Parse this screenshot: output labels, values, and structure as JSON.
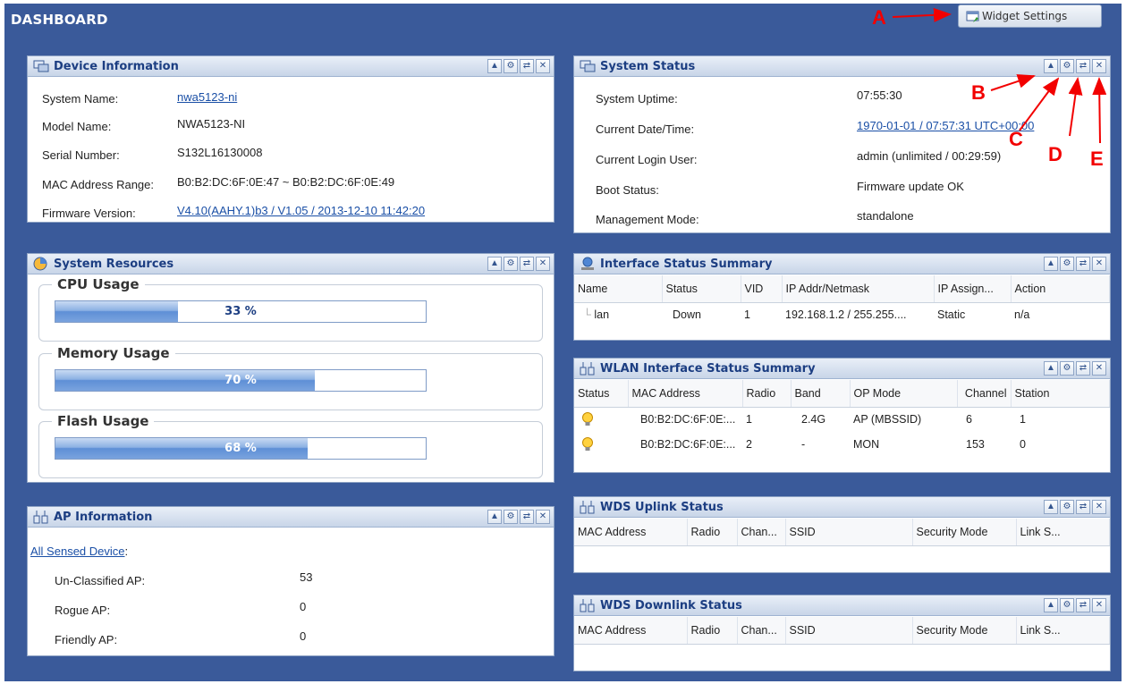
{
  "header": {
    "title": "DASHBOARD",
    "widget_settings": "Widget Settings"
  },
  "annotations": {
    "a": "A",
    "b": "B",
    "c": "C",
    "d": "D",
    "e": "E"
  },
  "device_info": {
    "title": "Device Information",
    "rows": [
      {
        "label": "System Name:",
        "value": "nwa5123-ni"
      },
      {
        "label": "Model Name:",
        "value": "NWA5123-NI"
      },
      {
        "label": "Serial Number:",
        "value": "S132L16130008"
      },
      {
        "label": "MAC Address Range:",
        "value": "B0:B2:DC:6F:0E:47 ~ B0:B2:DC:6F:0E:49"
      },
      {
        "label": "Firmware Version:",
        "value": "V4.10(AAHY.1)b3 / V1.05 / 2013-12-10 11:42:20"
      }
    ]
  },
  "system_resources": {
    "title": "System Resources",
    "items": [
      {
        "label": "CPU Usage",
        "text": "33 %",
        "percent": 33
      },
      {
        "label": "Memory Usage",
        "text": "70 %",
        "percent": 70
      },
      {
        "label": "Flash Usage",
        "text": "68 %",
        "percent": 68
      }
    ]
  },
  "ap_info": {
    "title": "AP Information",
    "all_sensed": "All Sensed Device",
    "colon": ":",
    "rows": [
      {
        "label": "Un-Classified AP:",
        "value": "53"
      },
      {
        "label": "Rogue AP:",
        "value": "0"
      },
      {
        "label": "Friendly AP:",
        "value": "0"
      }
    ]
  },
  "system_status": {
    "title": "System Status",
    "rows": [
      {
        "label": "System Uptime:",
        "value": "07:55:30"
      },
      {
        "label": "Current Date/Time:",
        "value": "1970-01-01 / 07:57:31 UTC+00:00"
      },
      {
        "label": "Current Login User:",
        "value": "admin (unlimited / 00:29:59)"
      },
      {
        "label": "Boot Status:",
        "value": "Firmware update OK"
      },
      {
        "label": "Management Mode:",
        "value": "standalone"
      }
    ]
  },
  "interface_status": {
    "title": "Interface Status Summary",
    "columns": [
      "Name",
      "Status",
      "VID",
      "IP Addr/Netmask",
      "IP Assign...",
      "Action"
    ],
    "rows": [
      [
        "lan",
        "Down",
        "1",
        "192.168.1.2 / 255.255....",
        "Static",
        "n/a"
      ]
    ]
  },
  "wlan_status": {
    "title": "WLAN Interface Status Summary",
    "columns": [
      "Status",
      "MAC Address",
      "Radio",
      "Band",
      "OP Mode",
      "Channel",
      "Station"
    ],
    "rows": [
      [
        "B0:B2:DC:6F:0E:...",
        "1",
        "2.4G",
        "AP (MBSSID)",
        "6",
        "1"
      ],
      [
        "B0:B2:DC:6F:0E:...",
        "2",
        "-",
        "MON",
        "153",
        "0"
      ]
    ]
  },
  "wds_uplink": {
    "title": "WDS Uplink Status",
    "columns": [
      "MAC Address",
      "Radio",
      "Chan...",
      "SSID",
      "Security Mode",
      "Link S..."
    ]
  },
  "wds_downlink": {
    "title": "WDS Downlink Status",
    "columns": [
      "MAC Address",
      "Radio",
      "Chan...",
      "SSID",
      "Security Mode",
      "Link S..."
    ]
  },
  "colors": {
    "dashboard_bg": "#3a5a9a",
    "panel_title": "#1c3e82",
    "link": "#1a4fa6",
    "annotation": "#f20000"
  }
}
